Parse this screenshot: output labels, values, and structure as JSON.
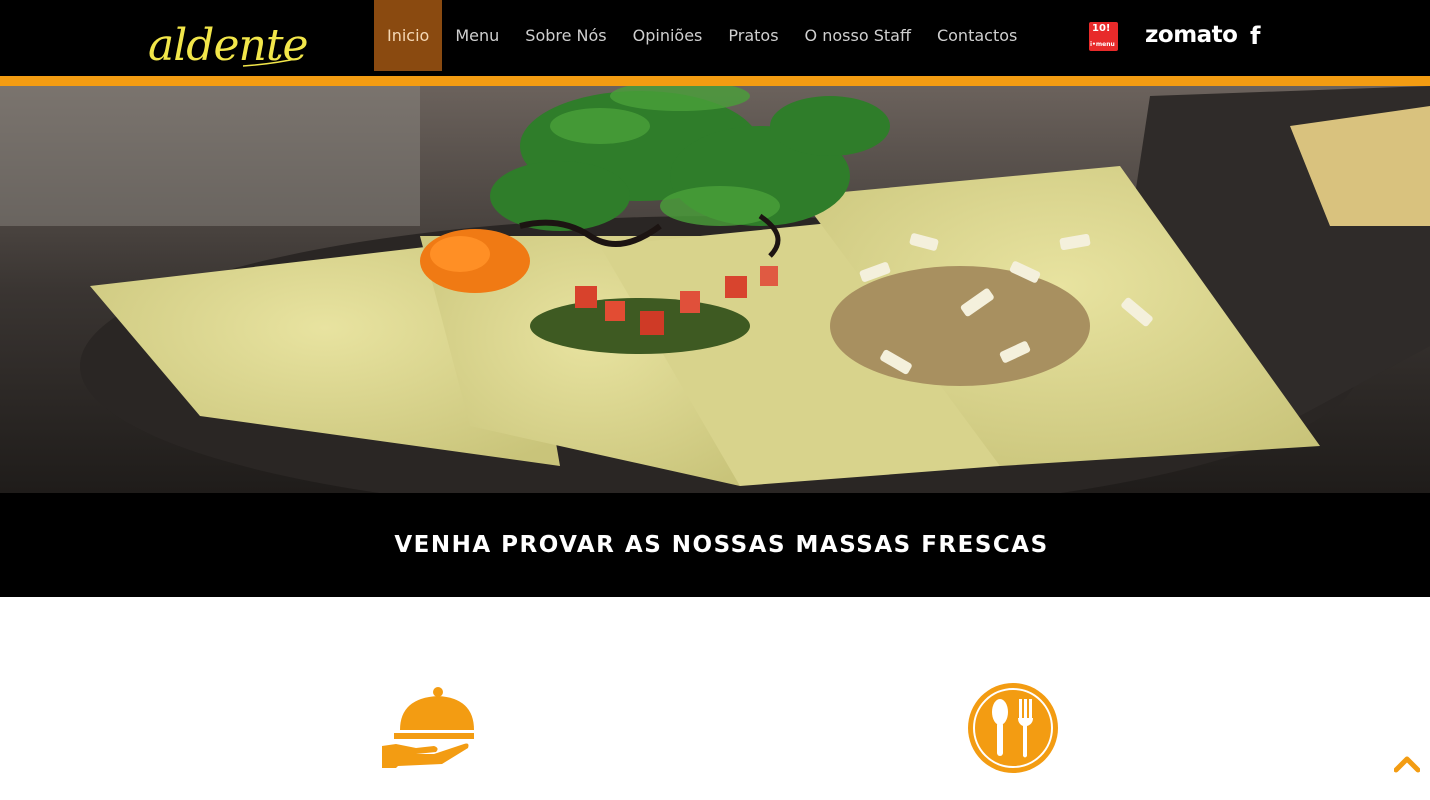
{
  "brand": {
    "logo_text": "aldente"
  },
  "nav": {
    "items": [
      {
        "label": "Inicio",
        "active": true
      },
      {
        "label": "Menu"
      },
      {
        "label": "Sobre Nós"
      },
      {
        "label": "Opiniões"
      },
      {
        "label": "Pratos"
      },
      {
        "label": "O nosso Staff"
      },
      {
        "label": "Contactos"
      }
    ]
  },
  "social": {
    "imenu_top": "10!",
    "imenu_bottom": "i•menu",
    "zomato_label": "zomato",
    "facebook_icon": "f"
  },
  "hero": {
    "image": "fresh ravioli plate"
  },
  "banner": {
    "title": "VENHA PROVAR AS NOSSAS MASSAS FRESCAS"
  },
  "colors": {
    "accent": "#f39c12",
    "nav_active": "#8a4a10",
    "logo": "#f2e64a",
    "header_bg": "#000000"
  },
  "icons": [
    "cloche-icon",
    "cutlery-icon",
    "scroll-top-icon"
  ]
}
